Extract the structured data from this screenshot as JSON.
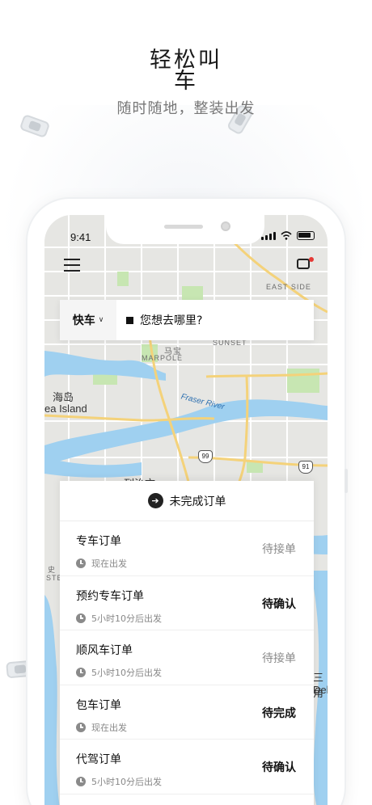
{
  "headline": {
    "title": "轻松叫车",
    "subtitle": "随时随地，整装出发"
  },
  "status_bar": {
    "time": "9:41"
  },
  "map": {
    "labels": {
      "east_side": "EAST SIDE",
      "sunset": "SUNSET",
      "marpole_cn": "马宝",
      "marpole": "MARPOLE",
      "fraser_river": "Fraser River",
      "sea_island_cn": "海岛",
      "sea_island": "ea Island",
      "richmond_cn": "列治文",
      "steveston_cn": "史",
      "steveston": "STE",
      "delta_cn": "三角",
      "delta": "Del"
    },
    "shields": [
      "99",
      "91"
    ],
    "colors": {
      "land": "#e6e6e3",
      "water": "#9fd0f0",
      "park": "#c7e6b2",
      "highway": "#f4d27a"
    }
  },
  "toolbar": {
    "menu_icon": "hamburger-icon",
    "message_icon": "message-icon"
  },
  "search": {
    "car_type": "快车",
    "destination_placeholder": "您想去哪里?"
  },
  "orders": {
    "header": "未完成订单",
    "items": [
      {
        "title": "专车订单",
        "time": "现在出发",
        "status": "待接单",
        "status_style": "muted"
      },
      {
        "title": "预约专车订单",
        "time": "5小时10分后出发",
        "status": "待确认",
        "status_style": "strong"
      },
      {
        "title": "顺风车订单",
        "time": "5小时10分后出发",
        "status": "待接单",
        "status_style": "muted"
      },
      {
        "title": "包车订单",
        "time": "现在出发",
        "status": "待完成",
        "status_style": "strong"
      },
      {
        "title": "代驾订单",
        "time": "5小时10分后出发",
        "status": "待确认",
        "status_style": "strong"
      }
    ]
  }
}
